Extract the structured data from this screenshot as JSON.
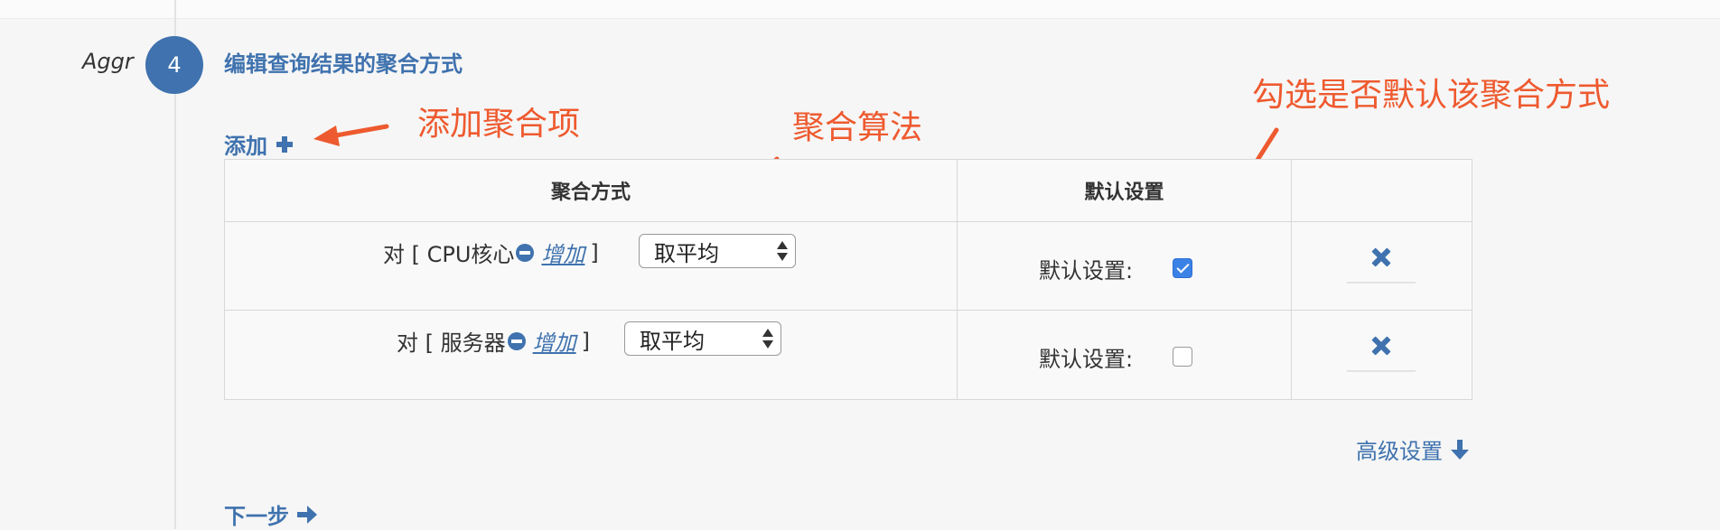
{
  "step": {
    "tag": "Aggr",
    "number": "4",
    "title": "编辑查询结果的聚合方式"
  },
  "add": {
    "label": "添加"
  },
  "annotations": {
    "add_item": "添加聚合项",
    "algorithm": "聚合算法",
    "default": "勾选是否默认该聚合方式"
  },
  "table": {
    "headers": [
      "聚合方式",
      "默认设置",
      ""
    ],
    "rows": [
      {
        "prefix": "对 [ CPU核心",
        "inc_label": "增加",
        "suffix": "]",
        "select_value": "取平均",
        "default_label": "默认设置:",
        "default_checked": true
      },
      {
        "prefix": "对 [ 服务器",
        "inc_label": "增加",
        "suffix": "]",
        "select_value": "取平均",
        "default_label": "默认设置:",
        "default_checked": false
      }
    ]
  },
  "advanced": {
    "label": "高级设置"
  },
  "next": {
    "label": "下一步"
  },
  "colors": {
    "accent": "#3f72ae",
    "annotation": "#ee5a2f",
    "checkbox_checked": "#3b82e6"
  },
  "icons": [
    "plus-icon",
    "minus-circle-icon",
    "select-arrows-icon",
    "check-icon",
    "close-icon",
    "arrow-down-icon",
    "arrow-right-icon",
    "annotation-arrow-icon"
  ]
}
